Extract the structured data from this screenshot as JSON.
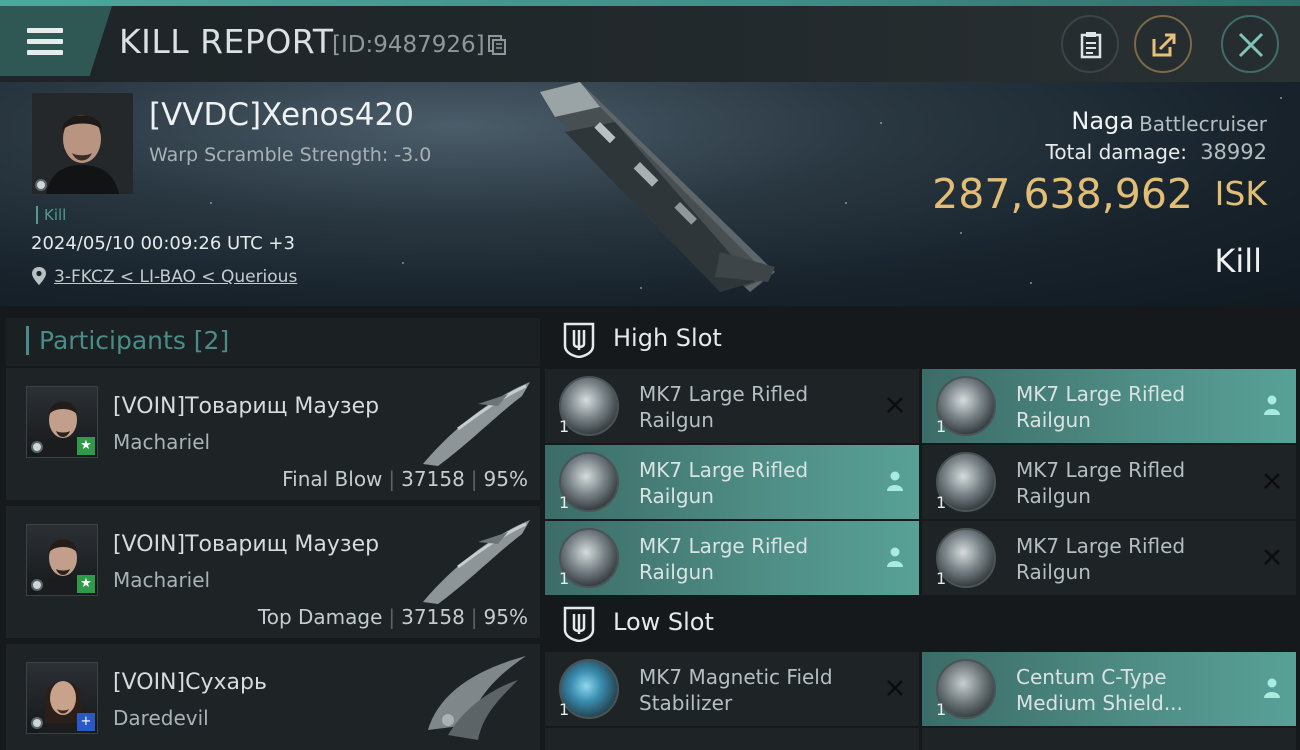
{
  "header": {
    "title": "KILL REPORT",
    "report_id": "[ID:9487926]",
    "buttons": [
      "clipboard-icon",
      "share-icon",
      "close-icon"
    ]
  },
  "victim": {
    "name": "[VVDC]Xenos420",
    "warp_scramble": "Warp Scramble Strength: -3.0",
    "tag": "Kill",
    "datetime": "2024/05/10 00:09:26 UTC +3",
    "location": "3-FKCZ < LI-BAO < Querious",
    "ship_name": "Naga",
    "ship_class": "Battlecruiser",
    "total_damage_label": "Total damage:",
    "total_damage": "38992",
    "isk_value": "287,638,962",
    "isk_unit": "ISK",
    "result": "Kill"
  },
  "participants": {
    "title": "Participants [2]",
    "items": [
      {
        "name": "[VOIN]Товарищ Маузер",
        "ship": "Machariel",
        "role": "Final Blow",
        "damage": "37158",
        "percent": "95%",
        "badge": "★"
      },
      {
        "name": "[VOIN]Товарищ Маузер",
        "ship": "Machariel",
        "role": "Top Damage",
        "damage": "37158",
        "percent": "95%",
        "badge": "★"
      },
      {
        "name": "[VOIN]Сухарь",
        "ship": "Daredevil",
        "role": "",
        "damage": "",
        "percent": "",
        "badge": "+"
      }
    ]
  },
  "slots": {
    "high": {
      "title": "High Slot",
      "modules": [
        {
          "name": "MK7 Large Rifled Railgun",
          "qty": "1",
          "status": "destroyed"
        },
        {
          "name": "MK7 Large Rifled Railgun",
          "qty": "1",
          "status": "dropped"
        },
        {
          "name": "MK7 Large Rifled Railgun",
          "qty": "1",
          "status": "dropped"
        },
        {
          "name": "MK7 Large Rifled Railgun",
          "qty": "1",
          "status": "destroyed"
        },
        {
          "name": "MK7 Large Rifled Railgun",
          "qty": "1",
          "status": "dropped"
        },
        {
          "name": "MK7 Large Rifled Railgun",
          "qty": "1",
          "status": "destroyed"
        }
      ]
    },
    "low": {
      "title": "Low Slot",
      "modules": [
        {
          "name": "MK7 Magnetic Field Stabilizer",
          "qty": "1",
          "status": "destroyed"
        },
        {
          "name": "Centum C-Type Medium Shield...",
          "qty": "1",
          "status": "dropped"
        }
      ]
    }
  },
  "colors": {
    "accent": "#4f9b8c",
    "isk": "#e2bd76",
    "fitted_bg": "#4f8e86"
  }
}
